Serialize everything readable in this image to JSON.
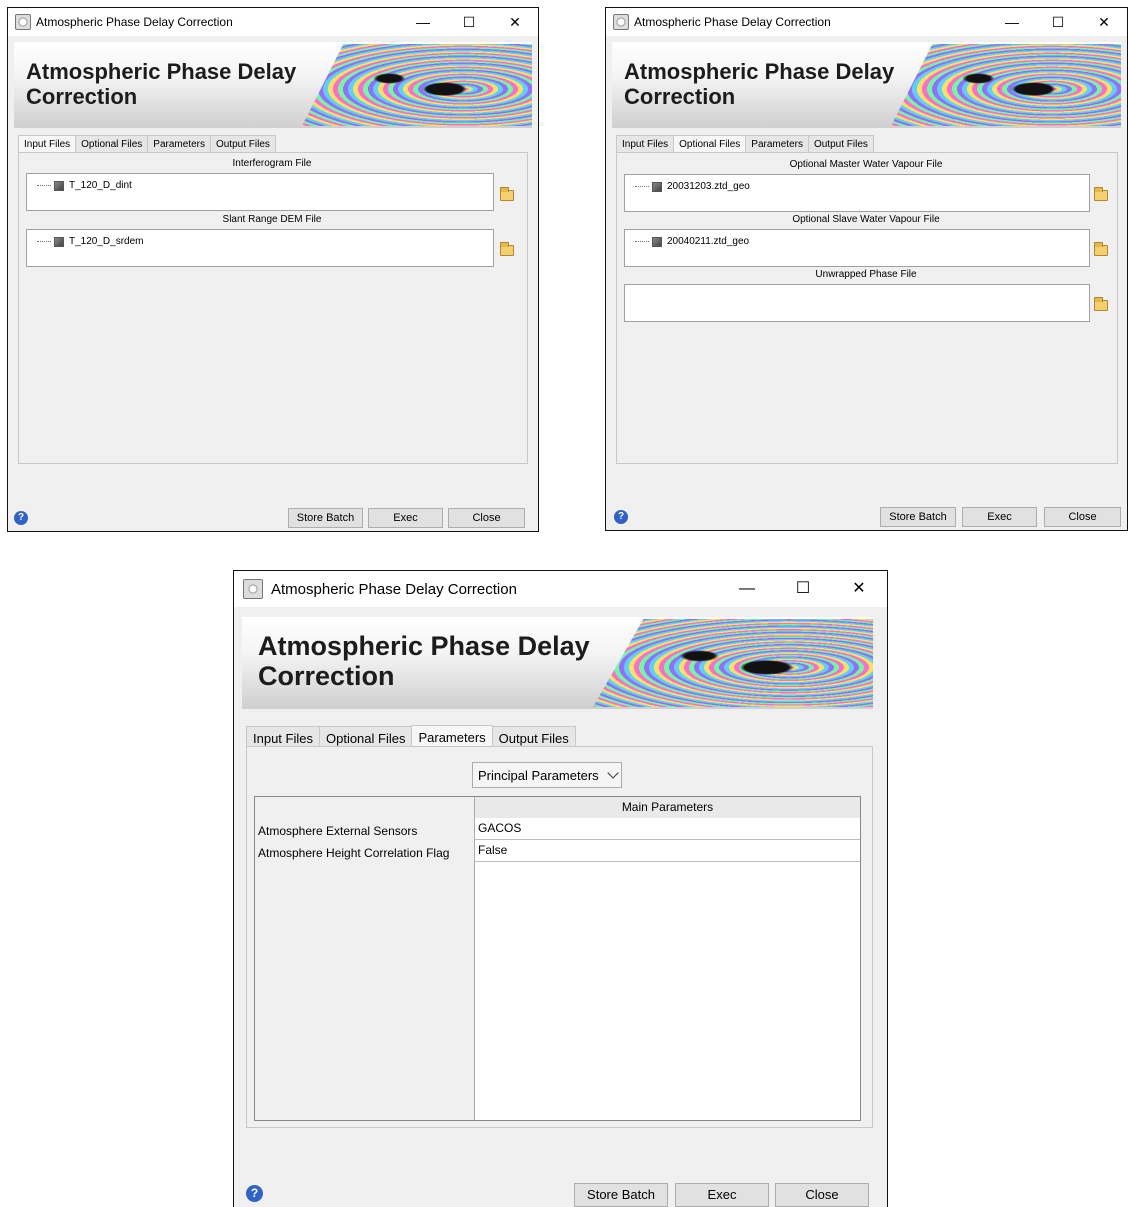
{
  "app": {
    "window_title": "Atmospheric Phase Delay Correction",
    "banner_title_line1": "Atmospheric Phase Delay",
    "banner_title_line2": "Correction",
    "controls": {
      "minimize": "—",
      "maximize": "☐",
      "close": "✕"
    }
  },
  "tabs": [
    "Input Files",
    "Optional Files",
    "Parameters",
    "Output Files"
  ],
  "buttons": {
    "store_batch": "Store Batch",
    "exec": "Exec",
    "close": "Close",
    "help": "?"
  },
  "window1": {
    "active_tab": "Input Files",
    "fields": [
      {
        "label": "Interferogram File",
        "value": "T_120_D_dint"
      },
      {
        "label": "Slant Range DEM File",
        "value": "T_120_D_srdem"
      }
    ]
  },
  "window2": {
    "active_tab": "Optional Files",
    "fields": [
      {
        "label": "Optional Master Water Vapour File",
        "value": "20031203.ztd_geo"
      },
      {
        "label": "Optional Slave Water Vapour File",
        "value": "20040211.ztd_geo"
      },
      {
        "label": "Unwrapped Phase File",
        "value": ""
      }
    ]
  },
  "window3": {
    "active_tab": "Parameters",
    "dropdown": "Principal Parameters",
    "table_header": "Main Parameters",
    "rows": [
      {
        "name": "Atmosphere External Sensors",
        "value": "GACOS"
      },
      {
        "name": "Atmosphere Height Correlation Flag",
        "value": "False"
      }
    ]
  },
  "colors": {
    "accent_help": "#2f63c7",
    "folder": "#f3cf6e",
    "window_bg": "#f0f0f0"
  }
}
